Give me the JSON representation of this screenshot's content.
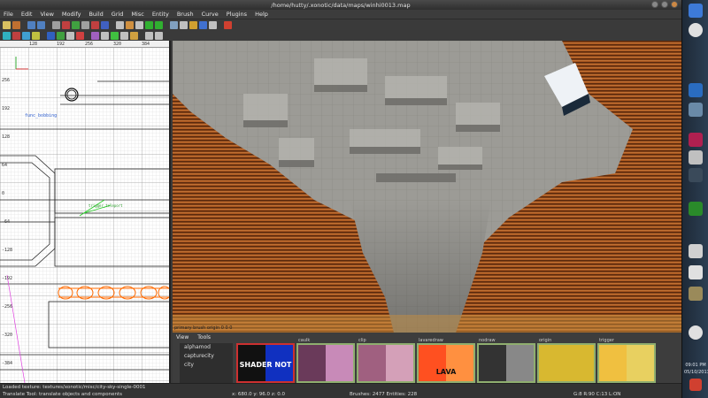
{
  "window": {
    "title": "/home/hutty/.xonotic/data/maps/winhi0013.map"
  },
  "menu": [
    "File",
    "Edit",
    "View",
    "Modify",
    "Build",
    "Grid",
    "Misc",
    "Entity",
    "Brush",
    "Curve",
    "Plugins",
    "Help"
  ],
  "grid2d": {
    "top_ticks": [
      "-128",
      "128",
      "192",
      "256",
      "320",
      "384"
    ],
    "left_ticks": [
      "256",
      "192",
      "128",
      "64",
      "0",
      "-64",
      "-128",
      "-192",
      "-256",
      "-320",
      "-384"
    ],
    "entity_label": "func_bobbing",
    "entity_label2": "trigger_teleport"
  },
  "view3d": {
    "overlay": "primary brush origin  0  0  0"
  },
  "texbrowser": {
    "menu": [
      "View",
      "Tools"
    ],
    "list": [
      "alphamod",
      "capturecity",
      "city"
    ],
    "thumbs": [
      {
        "name": "",
        "text": "SHADER NOT",
        "kind": "shader"
      },
      {
        "name": "caulk",
        "text": "",
        "kind": "caulk"
      },
      {
        "name": "clip",
        "text": "",
        "kind": "clip"
      },
      {
        "name": "lavaredraw",
        "text": "LAVA",
        "kind": "lava"
      },
      {
        "name": "nodraw",
        "text": "",
        "kind": "nodraw"
      },
      {
        "name": "origin",
        "text": "",
        "kind": "origin"
      },
      {
        "name": "trigger",
        "text": "",
        "kind": "trigger"
      }
    ]
  },
  "status": {
    "loaded": "Loaded texture: textures/xonotic/misc/city-sky-single-0001",
    "tool": "Translate Tool: translate objects and components",
    "coords": "x:  680.0  y:   96.0  z:    0.0",
    "counts": "Brushes: 2477 Entities: 228",
    "grid": "G:8  R:90  C:13  L:ON"
  },
  "dock": {
    "clock": "09:01 PM",
    "date": "05/10/2013"
  },
  "colors": {
    "wall_orange": "#b8652c",
    "stone_gray": "#9b9b97",
    "dock_blue": "#2c3e52"
  }
}
